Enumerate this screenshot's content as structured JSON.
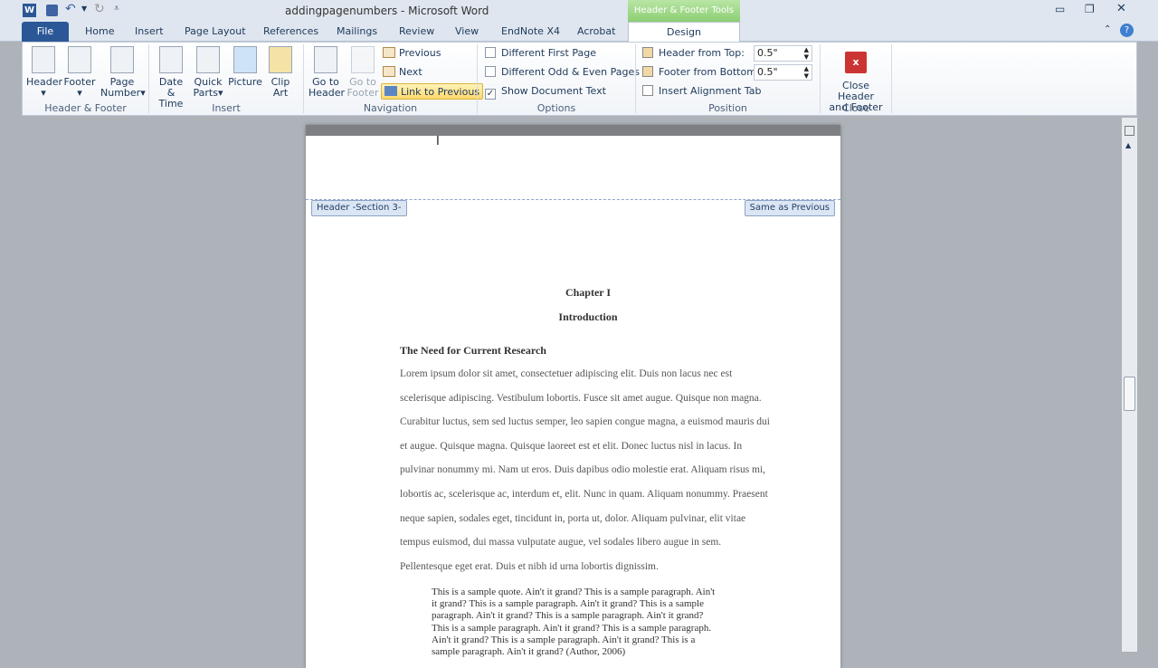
{
  "window": {
    "title": "addingpagenumbers - Microsoft Word",
    "context_tab": "Header & Footer Tools"
  },
  "tabs": [
    "File",
    "Home",
    "Insert",
    "Page Layout",
    "References",
    "Mailings",
    "Review",
    "View",
    "EndNote X4",
    "Acrobat",
    "Design"
  ],
  "ribbon": {
    "header_footer": {
      "label": "Header & Footer",
      "header": "Header",
      "footer": "Footer",
      "page_number": [
        "Page",
        "Number"
      ]
    },
    "insert": {
      "label": "Insert",
      "date_time": [
        "Date",
        "& Time"
      ],
      "quick_parts": [
        "Quick",
        "Parts"
      ],
      "picture": "Picture",
      "clip_art": [
        "Clip",
        "Art"
      ]
    },
    "navigation": {
      "label": "Navigation",
      "go_to_header": [
        "Go to",
        "Header"
      ],
      "go_to_footer": [
        "Go to",
        "Footer"
      ],
      "previous": "Previous",
      "next": "Next",
      "link_to_previous": "Link to Previous"
    },
    "options": {
      "label": "Options",
      "different_first_page": "Different First Page",
      "different_odd_even": "Different Odd & Even Pages",
      "show_document_text": "Show Document Text",
      "show_document_text_checked": true
    },
    "position": {
      "label": "Position",
      "header_from_top": "Header from Top:",
      "header_value": "0.5\"",
      "footer_from_bottom": "Footer from Bottom:",
      "footer_value": "0.5\"",
      "insert_alignment_tab": "Insert Alignment Tab"
    },
    "close": {
      "label": "Close",
      "close_button": [
        "Close Header",
        "and Footer"
      ]
    }
  },
  "document": {
    "header_tag": "Header -Section 3-",
    "same_as_previous": "Same as Previous",
    "chapter": "Chapter I",
    "subtitle": "Introduction",
    "heading": "The Need for Current Research",
    "body_lines": [
      "Lorem ipsum dolor sit amet, consectetuer adipiscing elit. Duis non lacus nec est",
      "scelerisque adipiscing. Vestibulum lobortis. Fusce sit amet augue. Quisque non magna.",
      "Curabitur luctus, sem sed luctus semper, leo sapien congue magna, a euismod mauris dui",
      "et augue. Quisque magna. Quisque laoreet est et elit. Donec luctus nisl in lacus. In",
      "pulvinar nonummy mi. Nam ut eros. Duis dapibus odio molestie erat. Aliquam risus mi,",
      "lobortis ac, scelerisque ac, interdum et, elit. Nunc in quam. Aliquam nonummy. Praesent",
      "neque sapien, sodales eget, tincidunt in, porta ut, dolor. Aliquam pulvinar, elit vitae",
      "tempus euismod, dui massa vulputate augue, vel sodales libero augue in sem.",
      "Pellentesque eget erat. Duis et nibh id urna lobortis dignissim."
    ],
    "quote_lines": [
      "This is a sample quote.  Ain't it grand? This is a sample paragraph.  Ain't",
      "it grand? This is a sample paragraph.  Ain't it grand? This is a sample",
      "paragraph.  Ain't it grand? This is a sample paragraph.  Ain't it grand?",
      "This is a sample paragraph.  Ain't it grand? This is a sample paragraph.",
      "Ain't it grand? This is a sample paragraph.  Ain't it grand? This is a",
      "sample paragraph.  Ain't it grand? (Author, 2006)"
    ]
  }
}
